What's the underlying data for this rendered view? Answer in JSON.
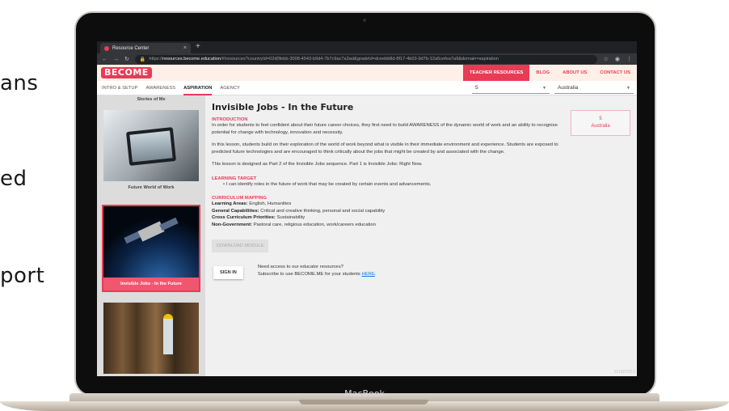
{
  "background_text": [
    "ans",
    "ed",
    "port"
  ],
  "laptop": {
    "brand": "MacBook"
  },
  "browser": {
    "tab_title": "Resource Center",
    "tab_close": "×",
    "new_tab": "+",
    "url_scheme": "https://",
    "url_host": "resources.become.education",
    "url_path": "/#/resources?countryId=02d0febb-3008-4543-b9d4-7b7c9ac7a3ad&gradeId=dceebb8d-8f17-4b03-9d7b-12a5cefea7a9&domain=aspiration"
  },
  "site": {
    "logo": "BECOME",
    "nav": [
      "TEACHER RESOURCES",
      "BLOG",
      "ABOUT US",
      "CONTACT US"
    ]
  },
  "subnav": {
    "tabs": [
      "INTRO & SETUP",
      "AWARENESS",
      "ASPIRATION",
      "AGENCY"
    ],
    "year_value": "5",
    "country_value": "Australia"
  },
  "sidebar": {
    "top_label": "Stories of Me",
    "cards": [
      "Future World of Work",
      "Invisible Jobs - In the Future"
    ]
  },
  "lesson": {
    "title": "Invisible Jobs - In the Future",
    "intro_heading": "INTRODUCTION",
    "intro_paragraphs": [
      "In order for students to feel confident about their future career choices, they first need to build AWARENESS of the dynamic world of work and an ability to recognise potential for change with technology, innovation and necessity.",
      "In this lesson, students build on their exploration of the world of work beyond what is visible in their immediate environment and experience. Students are exposed to predicted future technologies and are encouraged to think critically about the jobs that might be created by and associated with the change.",
      "This lesson is designed as Part 2 of the Invisible Jobs sequence. Part 1 is Invisible Jobs: Right Now."
    ],
    "target_heading": "LEARNING TARGET",
    "target_bullet": "• I can identify roles in the future of work that may be created by certain events and advancements.",
    "curriculum_heading": "CURRICULUM MAPPING",
    "curriculum": [
      {
        "label": "Learning Areas:",
        "value": " English, Humanities"
      },
      {
        "label": "General Capabilities:",
        "value": " Critical and creative thinking, personal and social capability"
      },
      {
        "label": "Cross Curriculum Priorities:",
        "value": " Sustainability"
      },
      {
        "label": "Non-Government:",
        "value": " Pastoral care, religious education, work/careers education"
      }
    ],
    "download_label": "DOWNLOAD MODULE",
    "signin_label": "SIGN IN",
    "access_line": "Need access to our educator resources?",
    "subscribe_prefix": "Subscribe to use BECOME.ME for your students ",
    "subscribe_link": "HERE",
    "subscribe_suffix": "."
  },
  "filter_box": {
    "year": "5",
    "country": "Australia"
  },
  "version": "20190729.5"
}
